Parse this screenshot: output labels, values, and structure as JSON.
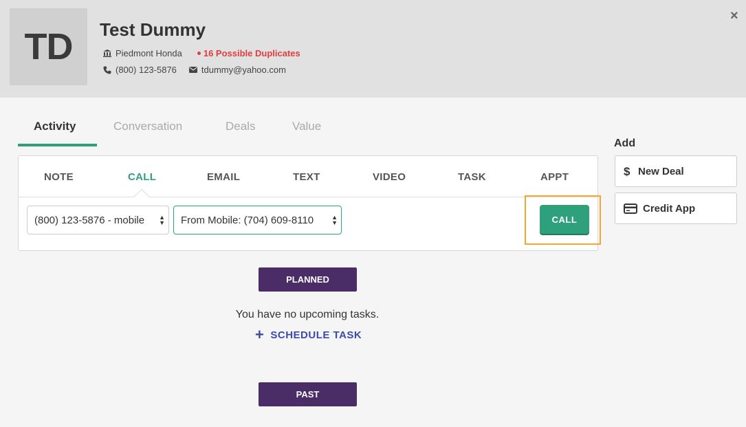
{
  "contact": {
    "initials": "TD",
    "name": "Test Dummy",
    "dealership": "Piedmont Honda",
    "duplicates": "16 Possible Duplicates",
    "phone": "(800) 123-5876",
    "email": "tdummy@yahoo.com"
  },
  "close_label": "×",
  "tabs": [
    {
      "label": "Activity",
      "active": true
    },
    {
      "label": "Conversation",
      "active": false
    },
    {
      "label": "Deals",
      "active": false
    },
    {
      "label": "Value",
      "active": false
    }
  ],
  "activity_tabs": [
    {
      "label": "NOTE"
    },
    {
      "label": "CALL",
      "active": true
    },
    {
      "label": "EMAIL"
    },
    {
      "label": "TEXT"
    },
    {
      "label": "VIDEO"
    },
    {
      "label": "TASK"
    },
    {
      "label": "APPT"
    }
  ],
  "call": {
    "to_number": "(800) 123-5876 - mobile",
    "from_number": "From Mobile: (704) 609-8110",
    "button_label": "CALL"
  },
  "add": {
    "title": "Add",
    "new_deal": "New Deal",
    "credit_app": "Credit App"
  },
  "tasks": {
    "planned_label": "PLANNED",
    "empty_text": "You have no upcoming tasks.",
    "schedule_label": "SCHEDULE TASK",
    "past_label": "PAST"
  },
  "colors": {
    "accent": "#2ea07b",
    "duplicate": "#e23d3d",
    "pill": "#4a2c66",
    "link": "#3b4ba6",
    "highlight": "#f0a830"
  }
}
